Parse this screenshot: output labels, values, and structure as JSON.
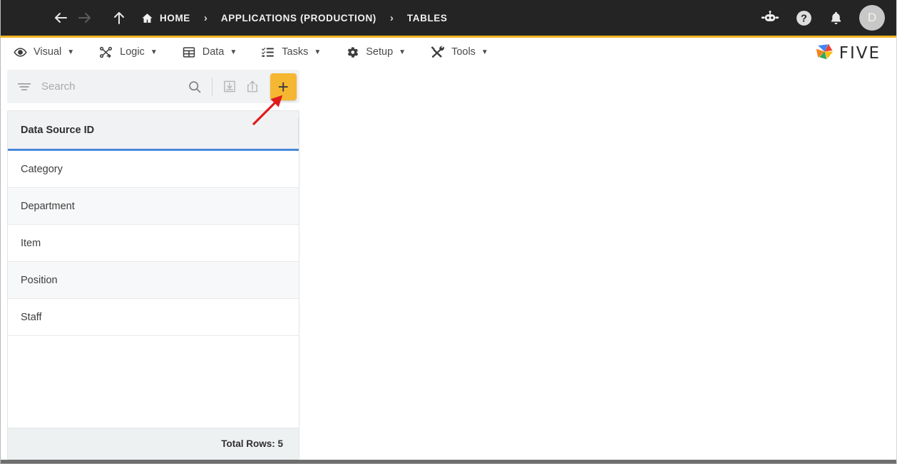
{
  "topbar": {
    "menu_icon": "hamburger-icon",
    "back_icon": "arrow-left-icon",
    "forward_icon": "arrow-right-icon",
    "up_icon": "arrow-up-icon",
    "breadcrumbs": [
      {
        "label": "HOME",
        "icon": "home-icon"
      },
      {
        "label": "APPLICATIONS (PRODUCTION)",
        "icon": ""
      },
      {
        "label": "TABLES",
        "icon": ""
      }
    ],
    "separator": "›",
    "actions": [
      {
        "name": "bot-icon",
        "title": ""
      },
      {
        "name": "help-icon",
        "title": "?"
      },
      {
        "name": "notifications-bell-icon",
        "title": ""
      }
    ],
    "avatar_initial": "D",
    "accent_color": "#f0b323",
    "background_color": "#242424"
  },
  "menubar": {
    "items": [
      {
        "label": "Visual",
        "icon": "eye-icon",
        "caret": "▼"
      },
      {
        "label": "Logic",
        "icon": "nodes-graph-icon",
        "caret": "▼"
      },
      {
        "label": "Data",
        "icon": "table-grid-icon",
        "caret": "▼"
      },
      {
        "label": "Tasks",
        "icon": "checklist-icon",
        "caret": "▼"
      },
      {
        "label": "Setup",
        "icon": "gear-icon",
        "caret": "▼"
      },
      {
        "label": "Tools",
        "icon": "tools-wrench-hammer-icon",
        "caret": "▼"
      }
    ],
    "brand_text": "FIVE",
    "brand_logo": "five-pinwheel-logo"
  },
  "toolbar": {
    "filter_icon": "filter-icon",
    "search_placeholder": "Search",
    "search_value": "",
    "search_icon": "search-icon",
    "import_icon": "import-download-icon",
    "export_icon": "export-share-icon",
    "add_label": "+",
    "add_icon": "plus-icon",
    "add_button_color": "#f5b731"
  },
  "grid": {
    "columns": [
      "Data Source ID"
    ],
    "header_underline_color": "#4a89dc",
    "rows": [
      {
        "data_source_id": "Category"
      },
      {
        "data_source_id": "Department"
      },
      {
        "data_source_id": "Item"
      },
      {
        "data_source_id": "Position"
      },
      {
        "data_source_id": "Staff"
      }
    ],
    "footer_label": "Total Rows: 5"
  },
  "annotation": {
    "arrow": "red-arrow-pointing-to-add-button",
    "color": "#e01b1b"
  }
}
